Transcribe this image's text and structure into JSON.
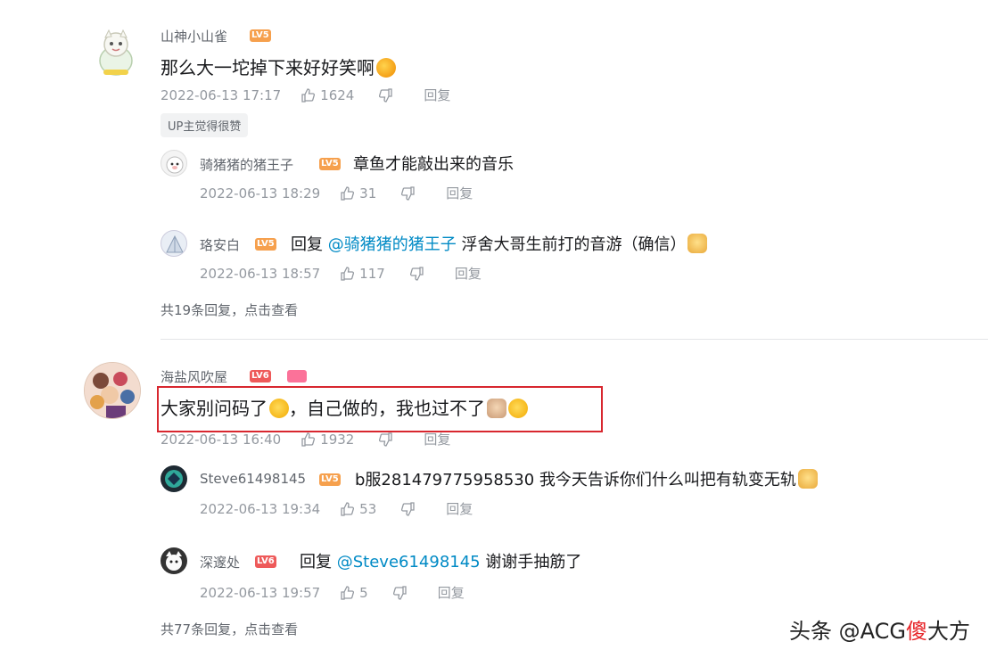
{
  "comments": [
    {
      "user": "山神小山雀",
      "level": "LV5",
      "text": "那么大一坨掉下来好好笑啊",
      "time": "2022-06-13 17:17",
      "likes": "1624",
      "reply_label": "回复",
      "up_tag": "UP主觉得很赞",
      "replies": [
        {
          "user": "骑猪猪的猪王子",
          "level": "LV5",
          "prefix": "",
          "mention": "",
          "text": "章鱼才能敲出来的音乐",
          "time": "2022-06-13 18:29",
          "likes": "31",
          "reply_label": "回复"
        },
        {
          "user": "珞安白",
          "level": "LV5",
          "prefix": "回复",
          "mention": "@骑猪猪的猪王子",
          "text": "浮舍大哥生前打的音游（确信）",
          "time": "2022-06-13 18:57",
          "likes": "117",
          "reply_label": "回复"
        }
      ],
      "more": "共19条回复，点击查看"
    },
    {
      "user": "海盐风吹屋",
      "level": "LV6",
      "text_a": "大家别问码了",
      "text_b": "，自己做的，我也过不了",
      "time": "2022-06-13 16:40",
      "likes": "1932",
      "reply_label": "回复",
      "replies": [
        {
          "user": "Steve61498145",
          "level": "LV5",
          "prefix": "",
          "mention": "",
          "text": "b服281479775958530 我今天告诉你们什么叫把有轨变无轨",
          "time": "2022-06-13 19:34",
          "likes": "53",
          "reply_label": "回复"
        },
        {
          "user": "深邃处",
          "level": "LV6",
          "prefix": "回复",
          "mention": "@Steve61498145",
          "text": "谢谢手抽筋了",
          "time": "2022-06-13 19:57",
          "likes": "5",
          "reply_label": "回复"
        }
      ],
      "more": "共77条回复，点击查看"
    }
  ],
  "watermark": {
    "prefix": "头条 @ACG",
    "red": "傻",
    "suffix": "大方"
  },
  "colors": {
    "level5": "#f6a04d",
    "level6": "#ee5a5a",
    "mention": "#008ac5",
    "highlight_box": "#d8272f"
  }
}
